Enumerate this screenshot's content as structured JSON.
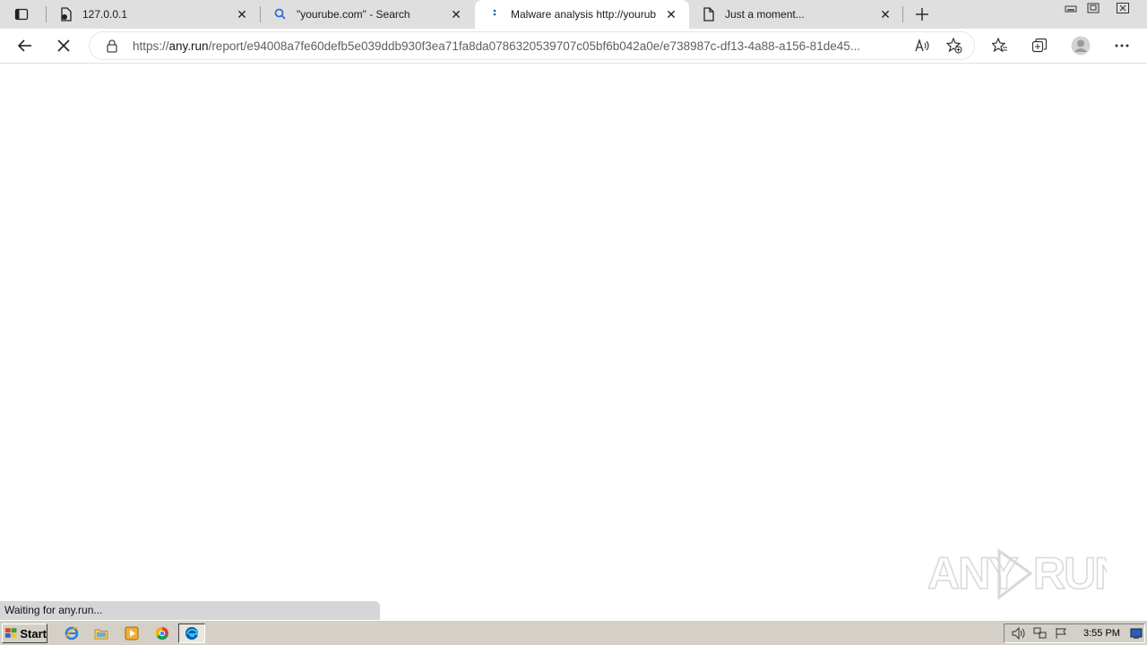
{
  "tabs": [
    {
      "title": "127.0.0.1",
      "icon": "page-lock-icon"
    },
    {
      "title": "\"yourube.com\" - Search",
      "icon": "search-icon"
    },
    {
      "title": "Malware analysis http://yourub",
      "icon": "loading-dots-icon",
      "active": true
    },
    {
      "title": "Just a moment...",
      "icon": "page-icon"
    }
  ],
  "address_bar": {
    "url_prefix": "https://",
    "url_host": "any.run",
    "url_path": "/report/e94008a7fe60defb5e039ddb930f3ea71fa8da0786320539707c05bf6b042a0e/e738987c-df13-4a88-a156-81de45..."
  },
  "status_bar": {
    "text": "Waiting for any.run..."
  },
  "taskbar": {
    "start_label": "Start",
    "clock": "3:55 PM"
  },
  "watermark": {
    "text": "ANY RUN"
  },
  "colors": {
    "tabbar_bg": "#dfdfdf",
    "taskbar_bg": "#d4d0c8",
    "edge_blue": "#0c59a4"
  }
}
